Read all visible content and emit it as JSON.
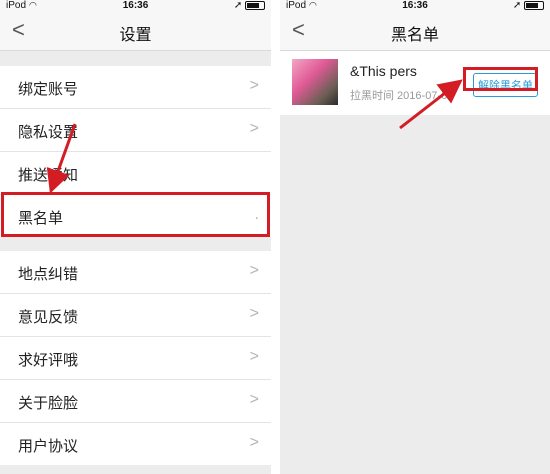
{
  "left": {
    "status": {
      "carrier": "iPod",
      "time": "16:36"
    },
    "nav": {
      "back": "<",
      "title": "设置"
    },
    "groups": [
      {
        "items": [
          {
            "label": "绑定账号",
            "chevron": ">"
          },
          {
            "label": "隐私设置",
            "chevron": ">"
          },
          {
            "label": "推送通知",
            "chevron": ""
          },
          {
            "label": "黑名单",
            "chevron": "."
          }
        ]
      },
      {
        "items": [
          {
            "label": "地点纠错",
            "chevron": ">"
          },
          {
            "label": "意见反馈",
            "chevron": ">"
          },
          {
            "label": "求好评哦",
            "chevron": ">"
          },
          {
            "label": "关于脸脸",
            "chevron": ">"
          },
          {
            "label": "用户协议",
            "chevron": ">"
          }
        ]
      }
    ]
  },
  "right": {
    "status": {
      "carrier": "iPod",
      "time": "16:36"
    },
    "nav": {
      "back": "<",
      "title": "黑名单"
    },
    "user": {
      "name": "&This pers",
      "time": "拉黑时间 2016-07-08",
      "unblock": "解除黑名单"
    }
  },
  "colors": {
    "highlight": "#d31c24",
    "link": "#2a9ad8"
  }
}
